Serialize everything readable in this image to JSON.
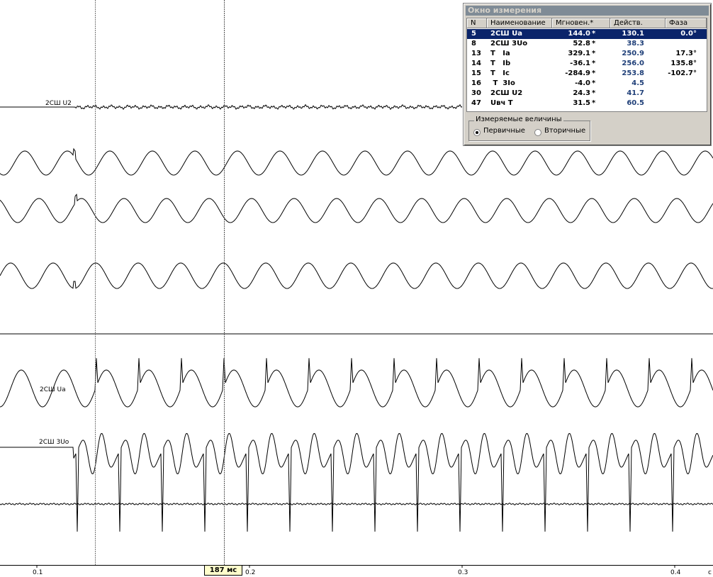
{
  "channels": {
    "u2_label": "2СШ U2",
    "ua_label": "2СШ Ua",
    "u0_label": "2СШ 3Uo"
  },
  "time_axis": {
    "ticks": [
      "0.1",
      "0.2",
      "0.3",
      "0.4"
    ],
    "unit": "с",
    "cursor_readout": "187 мс"
  },
  "measure_window": {
    "title": "Окно измерения",
    "columns": {
      "n": "N",
      "name": "Наименование",
      "instant": "Мгновен.*",
      "effective": "Действ.",
      "phase": "Фаза"
    },
    "rows": [
      {
        "n": "5",
        "name": "2СШ Ua",
        "instant": "144.0",
        "star": "*",
        "effective": "130.1",
        "phase": "0.0°",
        "selected": true
      },
      {
        "n": "8",
        "name": "2СШ 3Uo",
        "instant": "52.8",
        "star": "*",
        "effective": "38.3",
        "phase": ""
      },
      {
        "n": "13",
        "name": "T   Ia",
        "instant": "329.1",
        "star": "*",
        "effective": "250.9",
        "phase": "17.3°"
      },
      {
        "n": "14",
        "name": "T   Ib",
        "instant": "-36.1",
        "star": "*",
        "effective": "256.0",
        "phase": "135.8°"
      },
      {
        "n": "15",
        "name": "T   Ic",
        "instant": "-284.9",
        "star": "*",
        "effective": "253.8",
        "phase": "-102.7°"
      },
      {
        "n": "16",
        "name": " T  3Io",
        "instant": "-4.0",
        "star": "*",
        "effective": "4.5",
        "phase": ""
      },
      {
        "n": "30",
        "name": "2СШ U2",
        "instant": "24.3",
        "star": "*",
        "effective": "41.7",
        "phase": ""
      },
      {
        "n": "47",
        "name": "Uвч T",
        "instant": "31.5",
        "star": "*",
        "effective": "60.5",
        "phase": ""
      }
    ],
    "group_title": "Измеряемые величины",
    "option_primary": "Первичные",
    "option_secondary": "Вторичные",
    "selected_option": "primary"
  }
}
